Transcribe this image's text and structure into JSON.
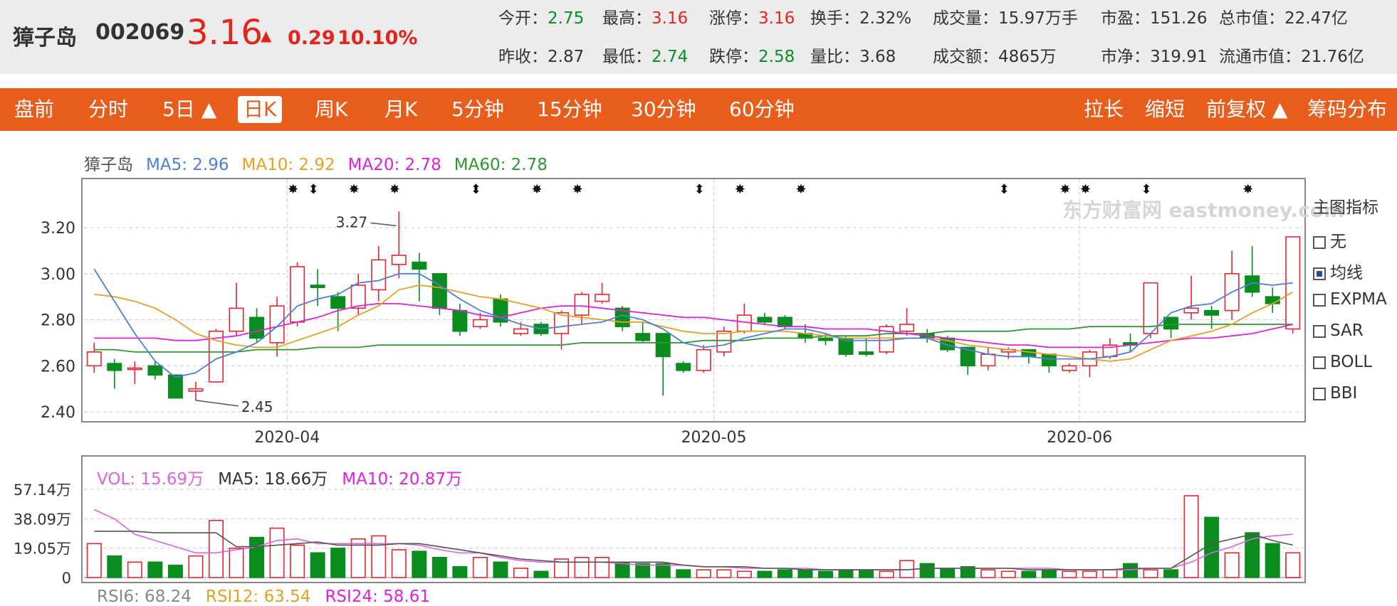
{
  "quote": {
    "name": "獐子岛",
    "code": "002069",
    "price": "3.16",
    "arrow": "▲",
    "change": "0.29",
    "change_pct": "10.10%",
    "rows": [
      [
        {
          "label": "今开：",
          "value": "2.75",
          "color": "green"
        },
        {
          "label": "最高：",
          "value": "3.16",
          "color": "red"
        },
        {
          "label": "涨停：",
          "value": "3.16",
          "color": "red"
        },
        {
          "label": "换手：",
          "value": "2.32%",
          "color": "plain"
        },
        {
          "label": "成交量：",
          "value": "15.97万手",
          "color": "plain"
        },
        {
          "label": "市盈：",
          "value": "151.26",
          "color": "plain"
        },
        {
          "label": "总市值：",
          "value": "22.47亿",
          "color": "plain"
        }
      ],
      [
        {
          "label": "昨收：",
          "value": "2.87",
          "color": "plain"
        },
        {
          "label": "最低：",
          "value": "2.74",
          "color": "green"
        },
        {
          "label": "跌停：",
          "value": "2.58",
          "color": "green"
        },
        {
          "label": "量比：",
          "value": "3.68",
          "color": "plain"
        },
        {
          "label": "成交额：",
          "value": "4865万",
          "color": "plain"
        },
        {
          "label": "市净：",
          "value": "319.91",
          "color": "plain"
        },
        {
          "label": "流通市值：",
          "value": "21.76亿",
          "color": "plain"
        }
      ]
    ]
  },
  "tabs": [
    "盘前",
    "分时",
    "5日 ▲",
    "日K",
    "周K",
    "月K",
    "5分钟",
    "15分钟",
    "30分钟",
    "60分钟"
  ],
  "active_tab": "日K",
  "right_tabs": [
    "拉长",
    "缩短",
    "前复权 ▲",
    "筹码分布"
  ],
  "ma_legend": {
    "name": "獐子岛",
    "items": [
      {
        "text": "MA5: 2.96",
        "color": "#4a7fe0"
      },
      {
        "text": "MA10: 2.92",
        "color": "#e8a020"
      },
      {
        "text": "MA20: 2.78",
        "color": "#e020e0"
      },
      {
        "text": "MA60: 2.78",
        "color": "#2a9a30"
      }
    ]
  },
  "vol_legend": [
    {
      "text": "VOL: 15.69万",
      "color": "#e060e0"
    },
    {
      "text": "MA5: 18.66万",
      "color": "#333333"
    },
    {
      "text": "MA10: 20.87万",
      "color": "#e020e0"
    }
  ],
  "rsi_legend": [
    {
      "text": "RSI6: 68.24",
      "color": "#888888"
    },
    {
      "text": "RSI12: 63.54",
      "color": "#e8a020"
    },
    {
      "text": "RSI24: 58.61",
      "color": "#e020e0"
    }
  ],
  "side_panel": {
    "title": "主图指标",
    "options": [
      {
        "label": "无",
        "checked": false
      },
      {
        "label": "均线",
        "checked": true
      },
      {
        "label": "EXPMA",
        "checked": false
      },
      {
        "label": "SAR",
        "checked": false
      },
      {
        "label": "BOLL",
        "checked": false
      },
      {
        "label": "BBI",
        "checked": false
      }
    ]
  },
  "watermark": "东方财富网 eastmoney.com",
  "chart_data": {
    "type": "candlestick",
    "y_ticks": [
      "3.20",
      "3.00",
      "2.80",
      "2.60",
      "2.40"
    ],
    "ylim": [
      2.36,
      3.41
    ],
    "x_labels": [
      {
        "label": "2020-04",
        "index": 10
      },
      {
        "label": "2020-05",
        "index": 31
      },
      {
        "label": "2020-06",
        "index": 49
      }
    ],
    "high_annotation": "3.27",
    "low_annotation": "2.45",
    "candles": [
      {
        "o": 2.6,
        "c": 2.66,
        "h": 2.7,
        "l": 2.57
      },
      {
        "o": 2.61,
        "c": 2.58,
        "h": 2.63,
        "l": 2.5
      },
      {
        "o": 2.59,
        "c": 2.59,
        "h": 2.62,
        "l": 2.52
      },
      {
        "o": 2.6,
        "c": 2.56,
        "h": 2.62,
        "l": 2.54
      },
      {
        "o": 2.56,
        "c": 2.46,
        "h": 2.56,
        "l": 2.46
      },
      {
        "o": 2.49,
        "c": 2.5,
        "h": 2.53,
        "l": 2.45
      },
      {
        "o": 2.53,
        "c": 2.75,
        "h": 2.76,
        "l": 2.53
      },
      {
        "o": 2.75,
        "c": 2.85,
        "h": 2.96,
        "l": 2.73
      },
      {
        "o": 2.81,
        "c": 2.72,
        "h": 2.85,
        "l": 2.7
      },
      {
        "o": 2.7,
        "c": 2.86,
        "h": 2.9,
        "l": 2.64
      },
      {
        "o": 2.79,
        "c": 3.03,
        "h": 3.05,
        "l": 2.77
      },
      {
        "o": 2.95,
        "c": 2.94,
        "h": 3.02,
        "l": 2.86
      },
      {
        "o": 2.9,
        "c": 2.85,
        "h": 2.92,
        "l": 2.75
      },
      {
        "o": 2.85,
        "c": 2.95,
        "h": 3.0,
        "l": 2.82
      },
      {
        "o": 2.93,
        "c": 3.06,
        "h": 3.12,
        "l": 2.88
      },
      {
        "o": 3.04,
        "c": 3.08,
        "h": 3.27,
        "l": 2.98
      },
      {
        "o": 3.05,
        "c": 3.02,
        "h": 3.09,
        "l": 2.88
      },
      {
        "o": 3.0,
        "c": 2.85,
        "h": 3.0,
        "l": 2.82
      },
      {
        "o": 2.84,
        "c": 2.75,
        "h": 2.87,
        "l": 2.73
      },
      {
        "o": 2.77,
        "c": 2.8,
        "h": 2.83,
        "l": 2.76
      },
      {
        "o": 2.89,
        "c": 2.79,
        "h": 2.91,
        "l": 2.77
      },
      {
        "o": 2.74,
        "c": 2.76,
        "h": 2.79,
        "l": 2.73
      },
      {
        "o": 2.78,
        "c": 2.74,
        "h": 2.79,
        "l": 2.73
      },
      {
        "o": 2.74,
        "c": 2.83,
        "h": 2.84,
        "l": 2.67
      },
      {
        "o": 2.82,
        "c": 2.91,
        "h": 2.92,
        "l": 2.78
      },
      {
        "o": 2.88,
        "c": 2.91,
        "h": 2.96,
        "l": 2.87
      },
      {
        "o": 2.85,
        "c": 2.77,
        "h": 2.86,
        "l": 2.75
      },
      {
        "o": 2.74,
        "c": 2.71,
        "h": 2.79,
        "l": 2.7
      },
      {
        "o": 2.74,
        "c": 2.64,
        "h": 2.74,
        "l": 2.47
      },
      {
        "o": 2.61,
        "c": 2.58,
        "h": 2.62,
        "l": 2.57
      },
      {
        "o": 2.58,
        "c": 2.67,
        "h": 2.69,
        "l": 2.57
      },
      {
        "o": 2.66,
        "c": 2.75,
        "h": 2.77,
        "l": 2.64
      },
      {
        "o": 2.75,
        "c": 2.82,
        "h": 2.87,
        "l": 2.74
      },
      {
        "o": 2.81,
        "c": 2.79,
        "h": 2.83,
        "l": 2.78
      },
      {
        "o": 2.81,
        "c": 2.77,
        "h": 2.82,
        "l": 2.76
      },
      {
        "o": 2.74,
        "c": 2.72,
        "h": 2.78,
        "l": 2.7
      },
      {
        "o": 2.72,
        "c": 2.71,
        "h": 2.74,
        "l": 2.69
      },
      {
        "o": 2.72,
        "c": 2.65,
        "h": 2.73,
        "l": 2.64
      },
      {
        "o": 2.66,
        "c": 2.65,
        "h": 2.72,
        "l": 2.64
      },
      {
        "o": 2.66,
        "c": 2.77,
        "h": 2.78,
        "l": 2.65
      },
      {
        "o": 2.75,
        "c": 2.78,
        "h": 2.85,
        "l": 2.73
      },
      {
        "o": 2.74,
        "c": 2.72,
        "h": 2.76,
        "l": 2.7
      },
      {
        "o": 2.72,
        "c": 2.67,
        "h": 2.73,
        "l": 2.66
      },
      {
        "o": 2.68,
        "c": 2.6,
        "h": 2.68,
        "l": 2.56
      },
      {
        "o": 2.6,
        "c": 2.65,
        "h": 2.68,
        "l": 2.58
      },
      {
        "o": 2.66,
        "c": 2.67,
        "h": 2.68,
        "l": 2.63
      },
      {
        "o": 2.67,
        "c": 2.64,
        "h": 2.67,
        "l": 2.61
      },
      {
        "o": 2.65,
        "c": 2.6,
        "h": 2.65,
        "l": 2.57
      },
      {
        "o": 2.58,
        "c": 2.6,
        "h": 2.61,
        "l": 2.57
      },
      {
        "o": 2.6,
        "c": 2.66,
        "h": 2.67,
        "l": 2.55
      },
      {
        "o": 2.64,
        "c": 2.69,
        "h": 2.72,
        "l": 2.63
      },
      {
        "o": 2.7,
        "c": 2.69,
        "h": 2.74,
        "l": 2.66
      },
      {
        "o": 2.74,
        "c": 2.96,
        "h": 2.96,
        "l": 2.72
      },
      {
        "o": 2.81,
        "c": 2.76,
        "h": 2.81,
        "l": 2.72
      },
      {
        "o": 2.83,
        "c": 2.85,
        "h": 2.99,
        "l": 2.8
      },
      {
        "o": 2.84,
        "c": 2.82,
        "h": 2.86,
        "l": 2.76
      },
      {
        "o": 2.84,
        "c": 3.0,
        "h": 3.1,
        "l": 2.8
      },
      {
        "o": 2.99,
        "c": 2.92,
        "h": 3.12,
        "l": 2.9
      },
      {
        "o": 2.9,
        "c": 2.87,
        "h": 2.94,
        "l": 2.83
      },
      {
        "o": 2.76,
        "c": 3.16,
        "h": 3.16,
        "l": 2.74
      }
    ],
    "ma5": [
      3.02,
      2.88,
      2.74,
      2.62,
      2.55,
      2.57,
      2.63,
      2.66,
      2.7,
      2.77,
      2.86,
      2.89,
      2.91,
      2.96,
      2.97,
      3.0,
      3.0,
      2.95,
      2.89,
      2.84,
      2.81,
      2.78,
      2.76,
      2.77,
      2.78,
      2.79,
      2.82,
      2.8,
      2.76,
      2.7,
      2.68,
      2.69,
      2.72,
      2.74,
      2.76,
      2.76,
      2.74,
      2.71,
      2.71,
      2.71,
      2.72,
      2.72,
      2.69,
      2.67,
      2.65,
      2.64,
      2.64,
      2.63,
      2.63,
      2.63,
      2.64,
      2.66,
      2.74,
      2.83,
      2.86,
      2.87,
      2.92,
      2.96,
      2.95,
      2.96
    ],
    "ma10": [
      2.91,
      2.9,
      2.88,
      2.85,
      2.8,
      2.74,
      2.71,
      2.69,
      2.68,
      2.68,
      2.71,
      2.74,
      2.77,
      2.82,
      2.86,
      2.93,
      2.95,
      2.94,
      2.92,
      2.9,
      2.89,
      2.87,
      2.85,
      2.82,
      2.81,
      2.8,
      2.79,
      2.79,
      2.77,
      2.75,
      2.74,
      2.74,
      2.75,
      2.75,
      2.75,
      2.74,
      2.73,
      2.72,
      2.72,
      2.72,
      2.72,
      2.72,
      2.71,
      2.69,
      2.68,
      2.67,
      2.66,
      2.65,
      2.64,
      2.63,
      2.62,
      2.63,
      2.67,
      2.71,
      2.73,
      2.75,
      2.78,
      2.83,
      2.87,
      2.92
    ],
    "ma20": [
      2.72,
      2.72,
      2.72,
      2.72,
      2.71,
      2.71,
      2.72,
      2.73,
      2.75,
      2.77,
      2.79,
      2.81,
      2.84,
      2.86,
      2.87,
      2.87,
      2.86,
      2.85,
      2.84,
      2.82,
      2.81,
      2.83,
      2.85,
      2.86,
      2.86,
      2.85,
      2.84,
      2.83,
      2.82,
      2.81,
      2.81,
      2.8,
      2.79,
      2.78,
      2.77,
      2.77,
      2.76,
      2.76,
      2.76,
      2.75,
      2.74,
      2.73,
      2.72,
      2.71,
      2.7,
      2.69,
      2.69,
      2.68,
      2.68,
      2.68,
      2.68,
      2.69,
      2.7,
      2.71,
      2.72,
      2.72,
      2.73,
      2.74,
      2.76,
      2.78
    ],
    "ma60": [
      2.67,
      2.67,
      2.66,
      2.66,
      2.66,
      2.66,
      2.66,
      2.66,
      2.67,
      2.67,
      2.67,
      2.68,
      2.68,
      2.68,
      2.69,
      2.69,
      2.69,
      2.69,
      2.69,
      2.69,
      2.69,
      2.69,
      2.69,
      2.69,
      2.7,
      2.7,
      2.7,
      2.7,
      2.7,
      2.7,
      2.71,
      2.71,
      2.71,
      2.72,
      2.72,
      2.72,
      2.73,
      2.73,
      2.73,
      2.74,
      2.74,
      2.74,
      2.75,
      2.75,
      2.75,
      2.75,
      2.76,
      2.76,
      2.76,
      2.77,
      2.77,
      2.77,
      2.77,
      2.78,
      2.78,
      2.78,
      2.78,
      2.78,
      2.78,
      2.78
    ],
    "volume_ticks": [
      "57.14万",
      "38.09万",
      "19.05万",
      "0"
    ],
    "volume_max": 57.14,
    "volumes": [
      22,
      14,
      10,
      10,
      8,
      14,
      37,
      19,
      26,
      32,
      21,
      16,
      19,
      25,
      27,
      18,
      17,
      13,
      7,
      13,
      10,
      6,
      4,
      12,
      13,
      13,
      10,
      9,
      9,
      5,
      5,
      5,
      4,
      4,
      5,
      5,
      4,
      5,
      5,
      4,
      11,
      9,
      6,
      7,
      5,
      4,
      4,
      5,
      4,
      4,
      5,
      9,
      5,
      5,
      53,
      39,
      16,
      29,
      22,
      13,
      16
    ],
    "vol_ma5": [
      30,
      30,
      30,
      29,
      29,
      29,
      29,
      20,
      20,
      21,
      22,
      23,
      21,
      21,
      21,
      22,
      22,
      20,
      18,
      16,
      14,
      12,
      11,
      10,
      10,
      10,
      10,
      10,
      10,
      8,
      7,
      7,
      7,
      6,
      6,
      5,
      5,
      5,
      5,
      5,
      5,
      6,
      6,
      6,
      6,
      6,
      5,
      5,
      5,
      5,
      5,
      6,
      6,
      6,
      14,
      22,
      25,
      28,
      24,
      21,
      20
    ],
    "vol_ma10": [
      44,
      38,
      28,
      24,
      20,
      16,
      16,
      18,
      20,
      24,
      25,
      22,
      22,
      22,
      22,
      22,
      21,
      18,
      16,
      16,
      13,
      11,
      10,
      10,
      10,
      10,
      9,
      8,
      8,
      8,
      7,
      7,
      6,
      6,
      6,
      6,
      5,
      5,
      5,
      5,
      5,
      6,
      6,
      6,
      6,
      6,
      6,
      6,
      5,
      5,
      5,
      5,
      6,
      6,
      10,
      16,
      20,
      25,
      27,
      28,
      21
    ]
  }
}
